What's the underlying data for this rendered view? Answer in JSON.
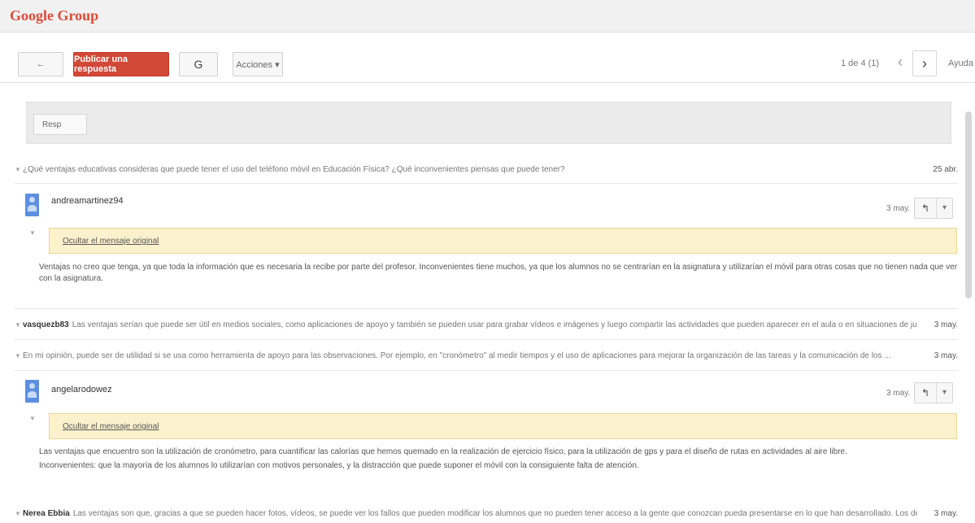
{
  "app": {
    "brand": "Google Group"
  },
  "toolbar": {
    "back_label": "←",
    "post_label": "Publicar una respuesta",
    "g_label": "G",
    "actions_label": "Acciones ▾",
    "range": "1 de 4 (1)",
    "prev": "‹",
    "next": "›",
    "help": "Ayuda"
  },
  "replybox": {
    "button_label": "Resp"
  },
  "thread": {
    "row1": {
      "author": "",
      "text": "¿Qué ventajas educativas consideras que puede tener el uso del teléfono móvil en Educación Física? ¿Qué inconvenientes piensas que puede tener?",
      "date": "25 abr."
    },
    "msg1": {
      "author": "andreamartinez94",
      "date": "3 may.",
      "quote": "Ocultar el mensaje original",
      "body": "Ventajas no creo que tenga, ya que toda la información que es necesaria la recibe por parte del profesor. Inconvenientes tiene muchos, ya que los alumnos no se centrarían en la asignatura y utilizarían el móvil para otras cosas que no tienen nada que ver con la asignatura."
    },
    "row2": {
      "author": "vasquezb83",
      "text": "Las ventajas serían que puede ser útil en medios sociales, como aplicaciones de apoyo y también se pueden usar para grabar vídeos e imágenes y luego compartir las actividades que pueden aparecer en el aula o en situaciones de juegos ...",
      "date": "3 may."
    },
    "row3": {
      "author": "",
      "text": "En mi opinión, puede ser de utilidad si se usa como herramienta de apoyo para las observaciones. Por ejemplo, en \"cronómetro\" al medir tiempos y el uso de aplicaciones para mejorar la organización de las tareas y la comunicación de los ...",
      "date": "3 may."
    },
    "msg2": {
      "author": "angelarodowez",
      "date": "3 may.",
      "quote": "Ocultar el mensaje original",
      "body_line1": "Las ventajas que encuentro son la utilización de cronómetro, para cuantificar las calorías que hemos quemado en la realización de ejercicio físico, para la utilización de gps y para el diseño de rutas en actividades al aire libre.",
      "body_line2": "Inconvenientes: que la mayoría de los alumnos lo utilizarían con motivos personales, y la distracción que puede suponer el móvil con la consiguiente falta de atención."
    },
    "row4": {
      "author": "Nerea Ebbia",
      "text": "Las ventajas son que, gracias a que se pueden hacer fotos, vídeos, se puede ver los fallos que pueden modificar los alumnos que no pueden tener acceso a la gente que conozcan pueda presentarse en lo que han desarrollado. Los desventajas, que ...",
      "date": "3 may."
    }
  }
}
